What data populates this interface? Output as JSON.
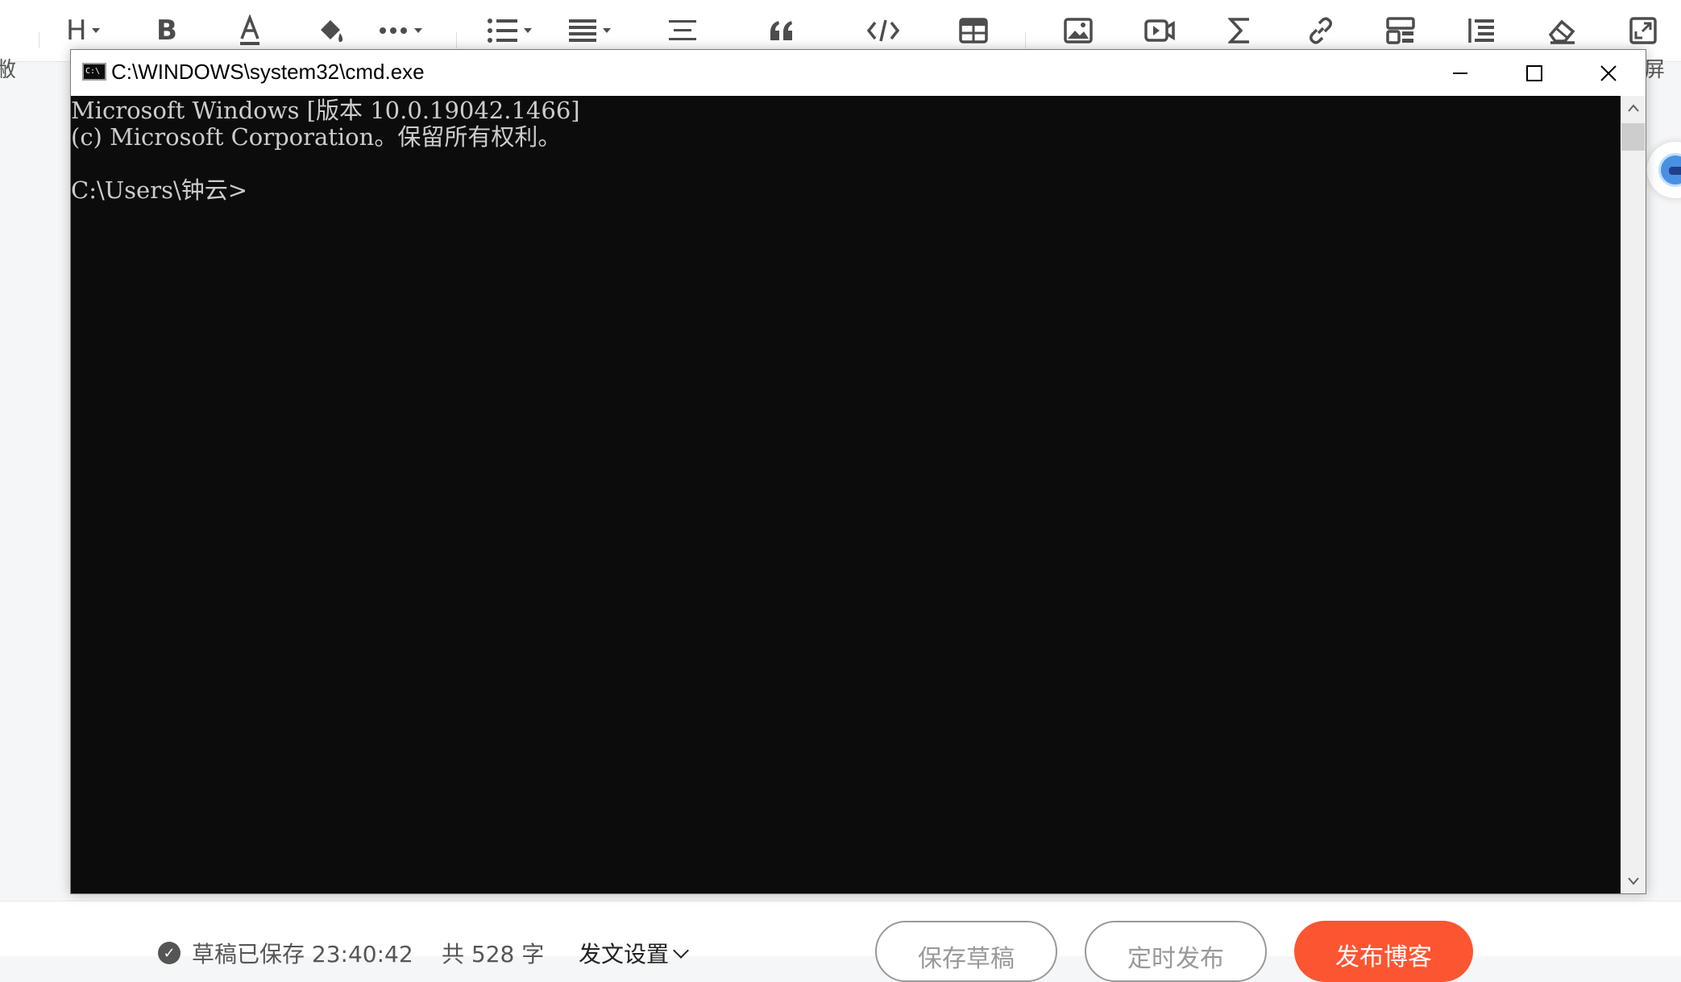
{
  "editor": {
    "left_edge_text": "敝",
    "right_edge_text": "屏",
    "toolbar": [
      {
        "name": "heading-button",
        "icon": "heading-icon",
        "has_dropdown": true
      },
      {
        "name": "bold-button",
        "icon": "bold-icon",
        "has_dropdown": false
      },
      {
        "name": "font-color-button",
        "icon": "font-color-icon",
        "has_dropdown": false
      },
      {
        "name": "fill-color-button",
        "icon": "paint-bucket-icon",
        "has_dropdown": false
      },
      {
        "name": "more-formatting-button",
        "icon": "more-icon",
        "has_dropdown": true
      },
      {
        "name": "list-button",
        "icon": "bulleted-list-icon",
        "has_dropdown": true
      },
      {
        "name": "align-button",
        "icon": "align-icon",
        "has_dropdown": true
      },
      {
        "name": "horizontal-rule-button",
        "icon": "horizontal-rule-icon",
        "has_dropdown": false
      },
      {
        "name": "quote-button",
        "icon": "quote-icon",
        "has_dropdown": false
      },
      {
        "name": "code-block-button",
        "icon": "code-icon",
        "has_dropdown": false
      },
      {
        "name": "table-button",
        "icon": "table-icon",
        "has_dropdown": false
      },
      {
        "name": "image-button",
        "icon": "image-icon",
        "has_dropdown": false
      },
      {
        "name": "video-button",
        "icon": "video-icon",
        "has_dropdown": false
      },
      {
        "name": "formula-button",
        "icon": "sigma-icon",
        "has_dropdown": false
      },
      {
        "name": "link-button",
        "icon": "link-icon",
        "has_dropdown": false
      },
      {
        "name": "template-button",
        "icon": "template-icon",
        "has_dropdown": false
      },
      {
        "name": "toc-button",
        "icon": "toc-icon",
        "has_dropdown": false
      },
      {
        "name": "eraser-button",
        "icon": "eraser-icon",
        "has_dropdown": false
      },
      {
        "name": "fullscreen-button",
        "icon": "fullscreen-icon",
        "has_dropdown": false
      }
    ],
    "bottom": {
      "save_status": "草稿已保存 23:40:42",
      "word_count": "共 528 字",
      "publish_settings": "发文设置",
      "save_draft_label": "保存草稿",
      "schedule_label": "定时发布",
      "publish_label": "发布博客"
    },
    "colors": {
      "primary": "#fc5531",
      "icon": "#4d4d4d"
    }
  },
  "cmd": {
    "title": "C:\\WINDOWS\\system32\\cmd.exe",
    "icon_text": "C:\\",
    "lines": [
      "Microsoft Windows [版本 10.0.19042.1466]",
      "(c) Microsoft Corporation。保留所有权利。",
      "",
      "C:\\Users\\钟云>"
    ],
    "colors": {
      "background": "#0c0c0c",
      "foreground": "#cccccc"
    }
  }
}
